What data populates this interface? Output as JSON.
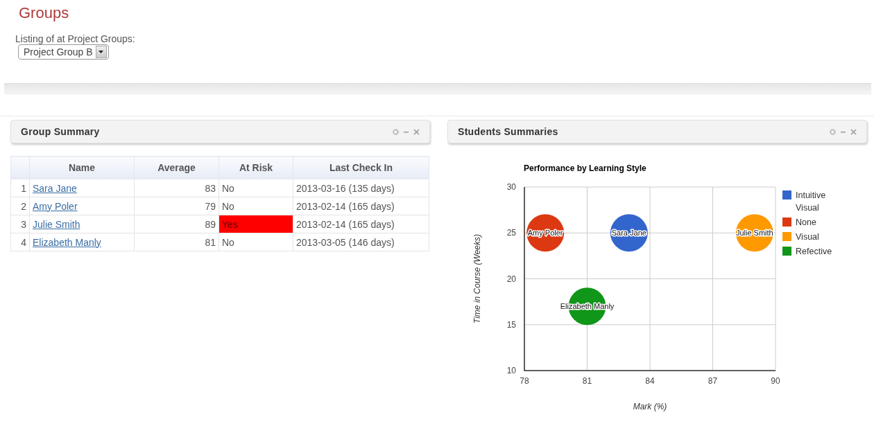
{
  "page_title": "Groups",
  "group_picker": {
    "label": "Listing of at Project Groups:",
    "value": "Project Group B"
  },
  "group_summary": {
    "title": "Group Summary",
    "columns": [
      "Name",
      "Average",
      "At Risk",
      "Last Check In"
    ],
    "rows": [
      {
        "index": "1",
        "name": "Sara Jane",
        "average": "83",
        "at_risk": "No",
        "flagged": false,
        "last_check_in": "2013-03-16 (135 days)"
      },
      {
        "index": "2",
        "name": "Amy Poler",
        "average": "79",
        "at_risk": "No",
        "flagged": false,
        "last_check_in": "2013-02-14 (165 days)"
      },
      {
        "index": "3",
        "name": "Julie Smith",
        "average": "89",
        "at_risk": "Yes",
        "flagged": true,
        "last_check_in": "2013-02-14 (165 days)"
      },
      {
        "index": "4",
        "name": "Elizabeth Manly",
        "average": "81",
        "at_risk": "No",
        "flagged": false,
        "last_check_in": "2013-03-05 (146 days)"
      }
    ]
  },
  "students_summaries": {
    "title": "Students Summaries",
    "chart_data": {
      "type": "scatter",
      "title": "Performance by Learning Style",
      "xlabel": "Mark (%)",
      "ylabel": "Time in Course (Weeks)",
      "x": [
        79,
        81,
        83,
        89
      ],
      "series": [
        {
          "name": "Intuitive Visual",
          "color": "#3366cc",
          "values": [
            null,
            null,
            25,
            null
          ]
        },
        {
          "name": "None",
          "color": "#dc3912",
          "values": [
            25,
            null,
            null,
            null
          ]
        },
        {
          "name": "Visual",
          "color": "#ff9900",
          "values": [
            null,
            null,
            null,
            25
          ]
        },
        {
          "name": "Refective",
          "color": "#109618",
          "values": [
            null,
            17,
            null,
            null
          ]
        }
      ],
      "grid": true,
      "legend": true,
      "xlim": [
        78,
        90
      ],
      "ylim": [
        10,
        30
      ],
      "xticks": [
        78,
        81,
        84,
        87,
        90
      ],
      "yticks": [
        10,
        15,
        20,
        25,
        30
      ],
      "annotations": [
        {
          "x": 79,
          "y": 25,
          "text": "Amy Poler"
        },
        {
          "x": 81,
          "y": 17,
          "text": "Elizabeth Manly"
        },
        {
          "x": 83,
          "y": 25,
          "text": "Sara Jane"
        },
        {
          "x": 89,
          "y": 25,
          "text": "Julie Smith"
        }
      ]
    }
  }
}
